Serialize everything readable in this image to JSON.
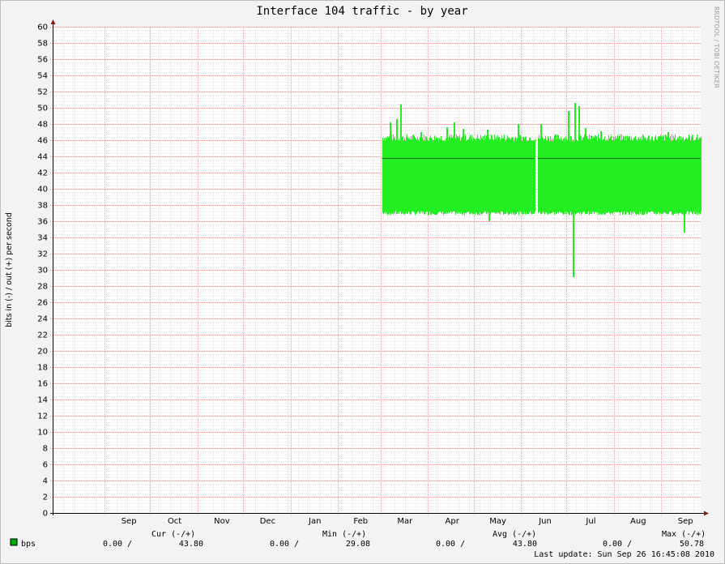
{
  "watermark": "RRDTOOL / TOBI OETIKER",
  "legend": {
    "headers": {
      "cur": "Cur (-/+)",
      "min": "Min (-/+)",
      "avg": "Avg (-/+)",
      "max": "Max (-/+)"
    },
    "series_label": "bps",
    "swatch_color": "#00aa00",
    "row": {
      "cur_in": "0.00 /",
      "cur_out": "43.80",
      "min_in": "0.00 /",
      "min_out": "29.08",
      "avg_in": "0.00 /",
      "avg_out": "43.80",
      "max_in": "0.00 /",
      "max_out": "50.78"
    },
    "last_update": "Last update: Sun Sep 26 16:45:08 2010"
  },
  "colors": {
    "area": "#22ee22",
    "line": "#1d7a1d",
    "major_grid": "#e89a9a",
    "minor_grid": "#d8c4c4",
    "canvas": "#ffffff",
    "background": "#f3f3f3",
    "arrow": "#8b1a1a"
  },
  "chart_data": {
    "type": "area",
    "title": "Interface 104 traffic - by year",
    "ylabel": "bits in (-) / out (+) per second",
    "xlabel": "",
    "ylim": [
      0,
      60
    ],
    "y_ticks": [
      0,
      2,
      4,
      6,
      8,
      10,
      12,
      14,
      16,
      18,
      20,
      22,
      24,
      26,
      28,
      30,
      32,
      34,
      36,
      38,
      40,
      42,
      44,
      46,
      48,
      50,
      52,
      54,
      56,
      58,
      60
    ],
    "x_range": [
      "2009-07-28",
      "2010-09-26"
    ],
    "x_month_labels": [
      {
        "label": "Sep",
        "date": "2009-09-16"
      },
      {
        "label": "Oct",
        "date": "2009-10-16"
      },
      {
        "label": "Nov",
        "date": "2009-11-16"
      },
      {
        "label": "Dec",
        "date": "2009-12-16"
      },
      {
        "label": "Jan",
        "date": "2010-01-16"
      },
      {
        "label": "Feb",
        "date": "2010-02-15"
      },
      {
        "label": "Mar",
        "date": "2010-03-16"
      },
      {
        "label": "Apr",
        "date": "2010-04-16"
      },
      {
        "label": "May",
        "date": "2010-05-16"
      },
      {
        "label": "Jun",
        "date": "2010-06-16"
      },
      {
        "label": "Jul",
        "date": "2010-07-16"
      },
      {
        "label": "Aug",
        "date": "2010-08-16"
      },
      {
        "label": "Sep",
        "date": "2010-09-16"
      }
    ],
    "x_major_grid_dates": [
      "2009-08-31",
      "2009-09-30",
      "2009-10-31",
      "2009-11-30",
      "2009-12-31",
      "2010-01-31",
      "2010-02-28",
      "2010-03-31",
      "2010-04-30",
      "2010-05-31",
      "2010-06-30",
      "2010-07-31",
      "2010-08-31"
    ],
    "grid": true,
    "legend_position": "bottom",
    "series": [
      {
        "name": "bps",
        "kind": "band",
        "segments": [
          {
            "start": "2010-03-01",
            "end": "2010-06-09",
            "low": 37.0,
            "high": 46.3
          },
          {
            "start": "2010-06-11",
            "end": "2010-09-26",
            "low": 37.0,
            "high": 46.3
          }
        ],
        "spikes_high": [
          {
            "date": "2010-03-06",
            "value": 48.2
          },
          {
            "date": "2010-03-10",
            "value": 48.6
          },
          {
            "date": "2010-03-13",
            "value": 50.4
          },
          {
            "date": "2010-03-26",
            "value": 47.0
          },
          {
            "date": "2010-04-12",
            "value": 47.6
          },
          {
            "date": "2010-04-17",
            "value": 48.2
          },
          {
            "date": "2010-04-23",
            "value": 47.4
          },
          {
            "date": "2010-05-09",
            "value": 47.3
          },
          {
            "date": "2010-05-29",
            "value": 48.0
          },
          {
            "date": "2010-06-13",
            "value": 48.0
          },
          {
            "date": "2010-07-01",
            "value": 49.6
          },
          {
            "date": "2010-07-05",
            "value": 50.6
          },
          {
            "date": "2010-07-08",
            "value": 50.2
          },
          {
            "date": "2010-07-12",
            "value": 47.5
          },
          {
            "date": "2010-07-22",
            "value": 47.1
          },
          {
            "date": "2010-09-04",
            "value": 47.0
          }
        ],
        "spikes_low": [
          {
            "date": "2010-05-10",
            "value": 36.0
          },
          {
            "date": "2010-07-04",
            "value": 29.1
          },
          {
            "date": "2010-09-15",
            "value": 34.6
          }
        ]
      },
      {
        "name": "bps average",
        "kind": "line",
        "segments": [
          {
            "start": "2010-03-01",
            "end": "2010-06-09",
            "value": 43.8
          },
          {
            "start": "2010-06-11",
            "end": "2010-09-26",
            "value": 43.8
          }
        ]
      }
    ]
  }
}
